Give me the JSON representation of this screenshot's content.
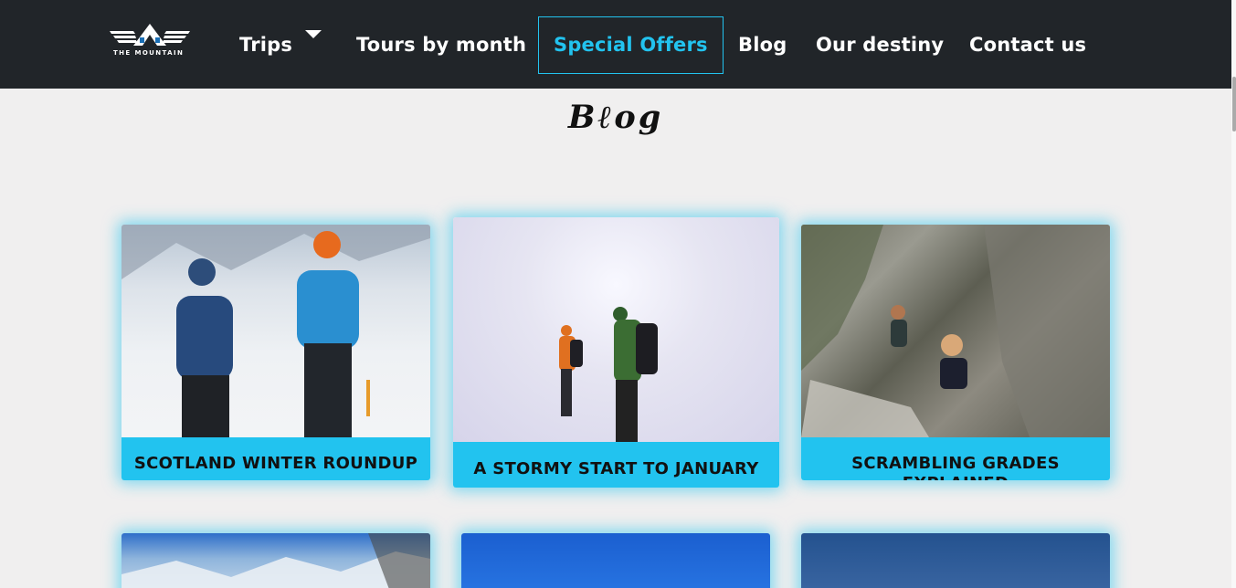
{
  "brand": {
    "logo_text": "THE MOUNTAIN"
  },
  "nav": {
    "items": [
      {
        "label": "Trips",
        "has_dropdown": true
      },
      {
        "label": "Tours by month"
      },
      {
        "label": "Special Offers",
        "active": true
      },
      {
        "label": "Blog"
      },
      {
        "label": "Our destiny"
      },
      {
        "label": "Contact us"
      }
    ]
  },
  "page": {
    "title": "Bℓog"
  },
  "cards": [
    {
      "caption": "SCOTLAND WINTER ROUNDUP",
      "image": "two climbers in snow with ice axes"
    },
    {
      "caption": "A STORMY START TO JANUARY",
      "image": "hikers in a snowstorm"
    },
    {
      "caption": "SCRAMBLING GRADES EXPLAINED",
      "image": "climbers scrambling up a rock gully"
    },
    {
      "caption": "",
      "image": "mountain peaks under blue sky"
    },
    {
      "caption": "",
      "image": "clear blue sky"
    },
    {
      "caption": "",
      "image": "dark blue sky"
    }
  ],
  "colors": {
    "nav_bg": "#212529",
    "accent": "#22c3ef",
    "page_bg": "#f0efef"
  }
}
